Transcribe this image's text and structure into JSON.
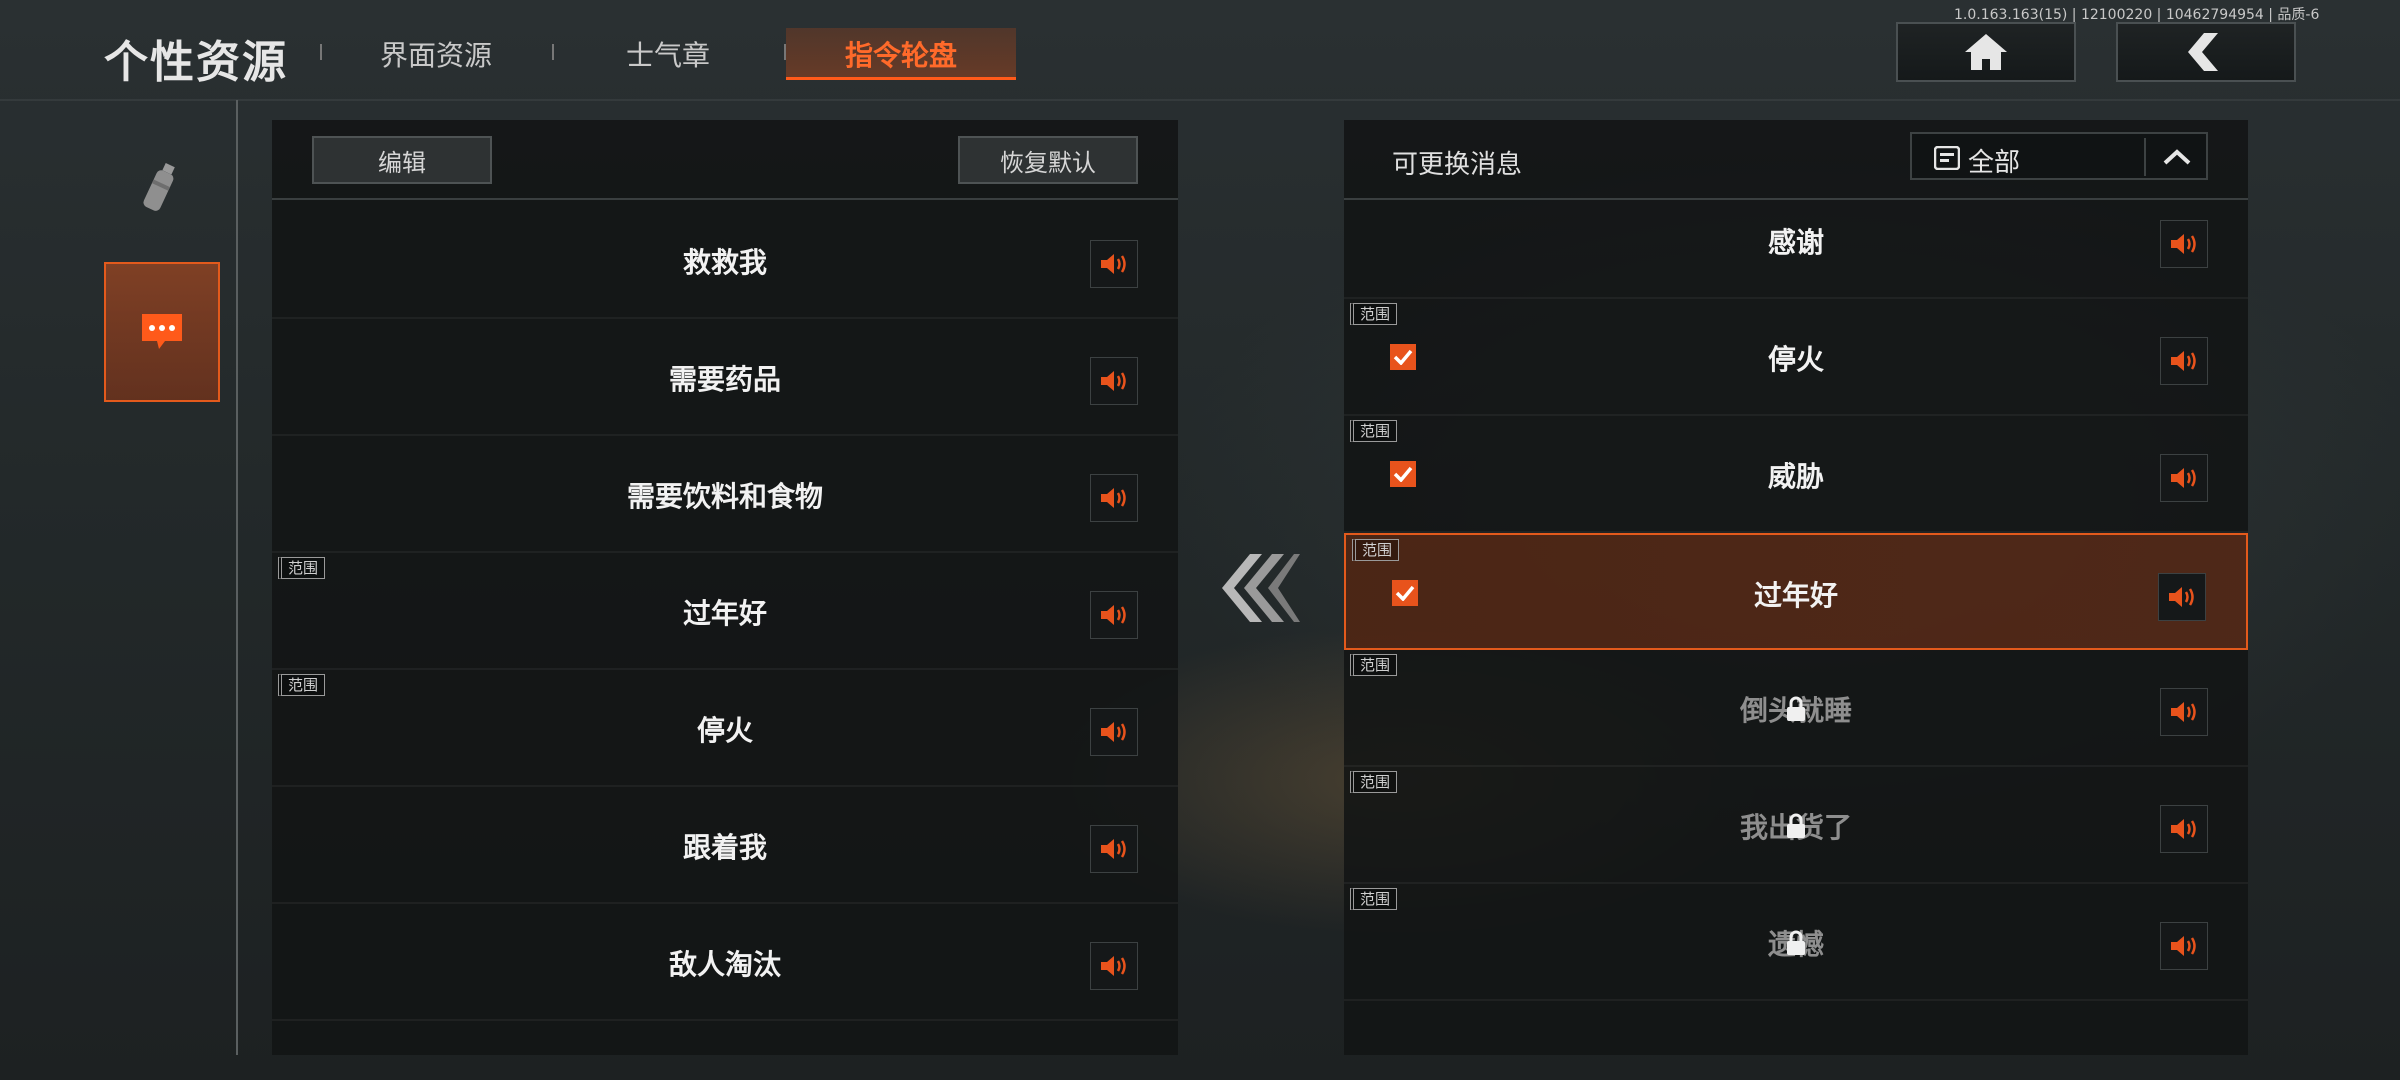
{
  "version": "1.0.163.163(15) | 12100220 | 10462794954 | 品质-6",
  "header": {
    "title": "个性资源",
    "tabs": [
      {
        "label": "界面资源",
        "active": false
      },
      {
        "label": "士气章",
        "active": false
      },
      {
        "label": "指令轮盘",
        "active": true
      }
    ],
    "home_icon": "home-icon",
    "back_icon": "back-arrow-icon"
  },
  "sidebar": {
    "items": [
      {
        "icon": "spray-can-icon",
        "active": false
      },
      {
        "icon": "chat-bubble-icon",
        "active": true
      }
    ]
  },
  "left_panel": {
    "edit_label": "编辑",
    "reset_label": "恢复默认",
    "rows": [
      {
        "label": "救救我",
        "range": null
      },
      {
        "label": "需要药品",
        "range": null
      },
      {
        "label": "需要饮料和食物",
        "range": null
      },
      {
        "label": "过年好",
        "range": "范围"
      },
      {
        "label": "停火",
        "range": "范围"
      },
      {
        "label": "跟着我",
        "range": null
      },
      {
        "label": "敌人淘汰",
        "range": null
      }
    ]
  },
  "right_panel": {
    "title": "可更换消息",
    "filter_label": "全部",
    "rows": [
      {
        "label": "感谢",
        "range": null,
        "checked": false,
        "locked": false,
        "selected": false
      },
      {
        "label": "停火",
        "range": "范围",
        "checked": true,
        "locked": false,
        "selected": false
      },
      {
        "label": "威胁",
        "range": "范围",
        "checked": true,
        "locked": false,
        "selected": false
      },
      {
        "label": "过年好",
        "range": "范围",
        "checked": true,
        "locked": false,
        "selected": true
      },
      {
        "label": "倒头就睡",
        "range": "范围",
        "checked": false,
        "locked": true,
        "selected": false
      },
      {
        "label": "我出货了",
        "range": "范围",
        "checked": false,
        "locked": true,
        "selected": false
      },
      {
        "label": "遗憾",
        "range": "范围",
        "checked": false,
        "locked": true,
        "selected": false
      }
    ]
  },
  "colors": {
    "accent": "#e8531c",
    "panel_bg": "#121415"
  }
}
